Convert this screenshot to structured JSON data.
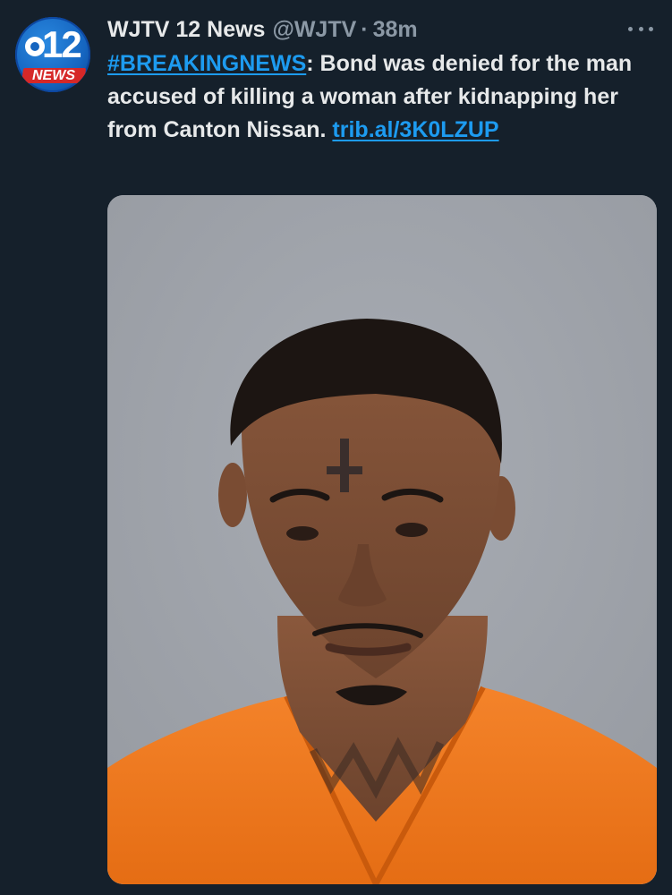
{
  "account": {
    "display_name": "WJTV 12 News",
    "handle": "@WJTV",
    "separator": "·",
    "time": "38m",
    "avatar": {
      "number": "12",
      "label": "NEWS",
      "brand_blue": "#1565c0",
      "brand_red": "#d62828"
    }
  },
  "tweet": {
    "hashtag": "#BREAKINGNEWS",
    "text": ": Bond was denied for the man accused of killing a woman after kidnapping her from Canton Nissan. ",
    "link": "trib.al/3K0LZUP"
  },
  "media": {
    "type": "photo",
    "colors": {
      "background": "#a0a4ab",
      "shirt": "#f07a1c",
      "skin": "#7b4e36"
    }
  },
  "theme": {
    "background": "#15202b",
    "text": "#e7e9ea",
    "muted": "#8b98a5",
    "link": "#1d9bf0"
  },
  "icons": {
    "more": "more-horizontal-icon"
  }
}
